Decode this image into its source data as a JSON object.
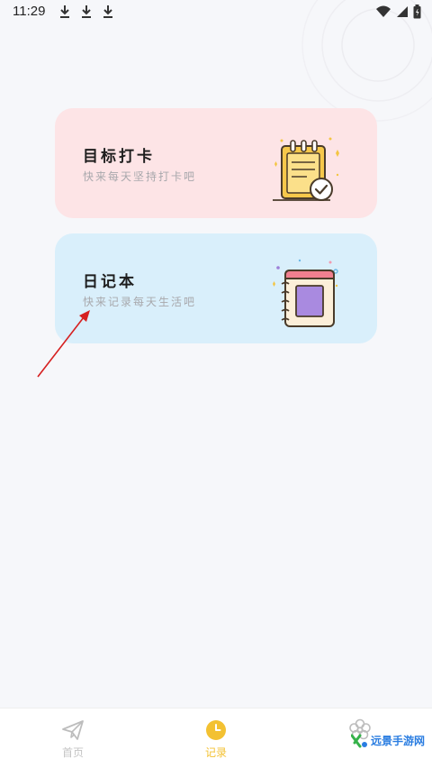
{
  "status_bar": {
    "time": "11:29",
    "icons": [
      "download-icon",
      "download-icon",
      "download-icon",
      "wifi-icon",
      "signal-icon",
      "battery-icon"
    ]
  },
  "cards": [
    {
      "title": "目标打卡",
      "subtitle": "快来每天坚持打卡吧",
      "icon": "clipboard-check-icon",
      "color": "#fde4e6"
    },
    {
      "title": "日记本",
      "subtitle": "快来记录每天生活吧",
      "icon": "notebook-icon",
      "color": "#d9effb"
    }
  ],
  "nav": {
    "items": [
      {
        "label": "首页",
        "icon": "paper-plane-icon",
        "active": false
      },
      {
        "label": "记录",
        "icon": "clock-icon",
        "active": true
      },
      {
        "label": "",
        "icon": "flower-icon",
        "active": false
      }
    ],
    "accent": "#f3c132"
  },
  "watermark": {
    "text": "远景手游网"
  }
}
